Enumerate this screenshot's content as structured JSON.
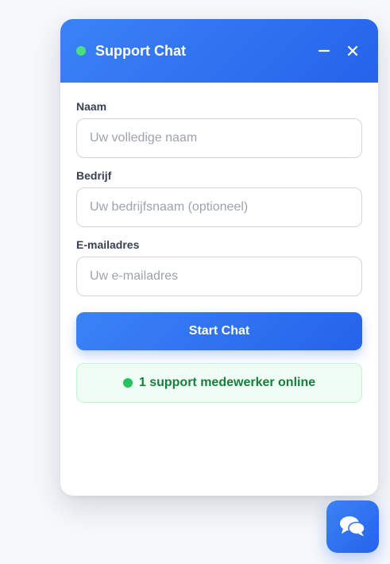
{
  "header": {
    "title": "Support Chat",
    "status_color": "#4ade80",
    "minimize_icon": "minus-icon",
    "close_icon": "close-icon"
  },
  "form": {
    "name": {
      "label": "Naam",
      "placeholder": "Uw volledige naam",
      "value": ""
    },
    "company": {
      "label": "Bedrijf",
      "placeholder": "Uw bedrijfsnaam (optioneel)",
      "value": ""
    },
    "email": {
      "label": "E-mailadres",
      "placeholder": "Uw e-mailadres",
      "value": ""
    },
    "submit_label": "Start Chat"
  },
  "status": {
    "text": "1 support medewerker online",
    "dot_color": "#22c55e"
  },
  "launcher": {
    "icon": "chat-bubbles-icon"
  },
  "colors": {
    "accent": "#3b82f6",
    "accent_dark": "#2563eb",
    "success_bg": "#f0fdf4",
    "success_text": "#15803d"
  }
}
